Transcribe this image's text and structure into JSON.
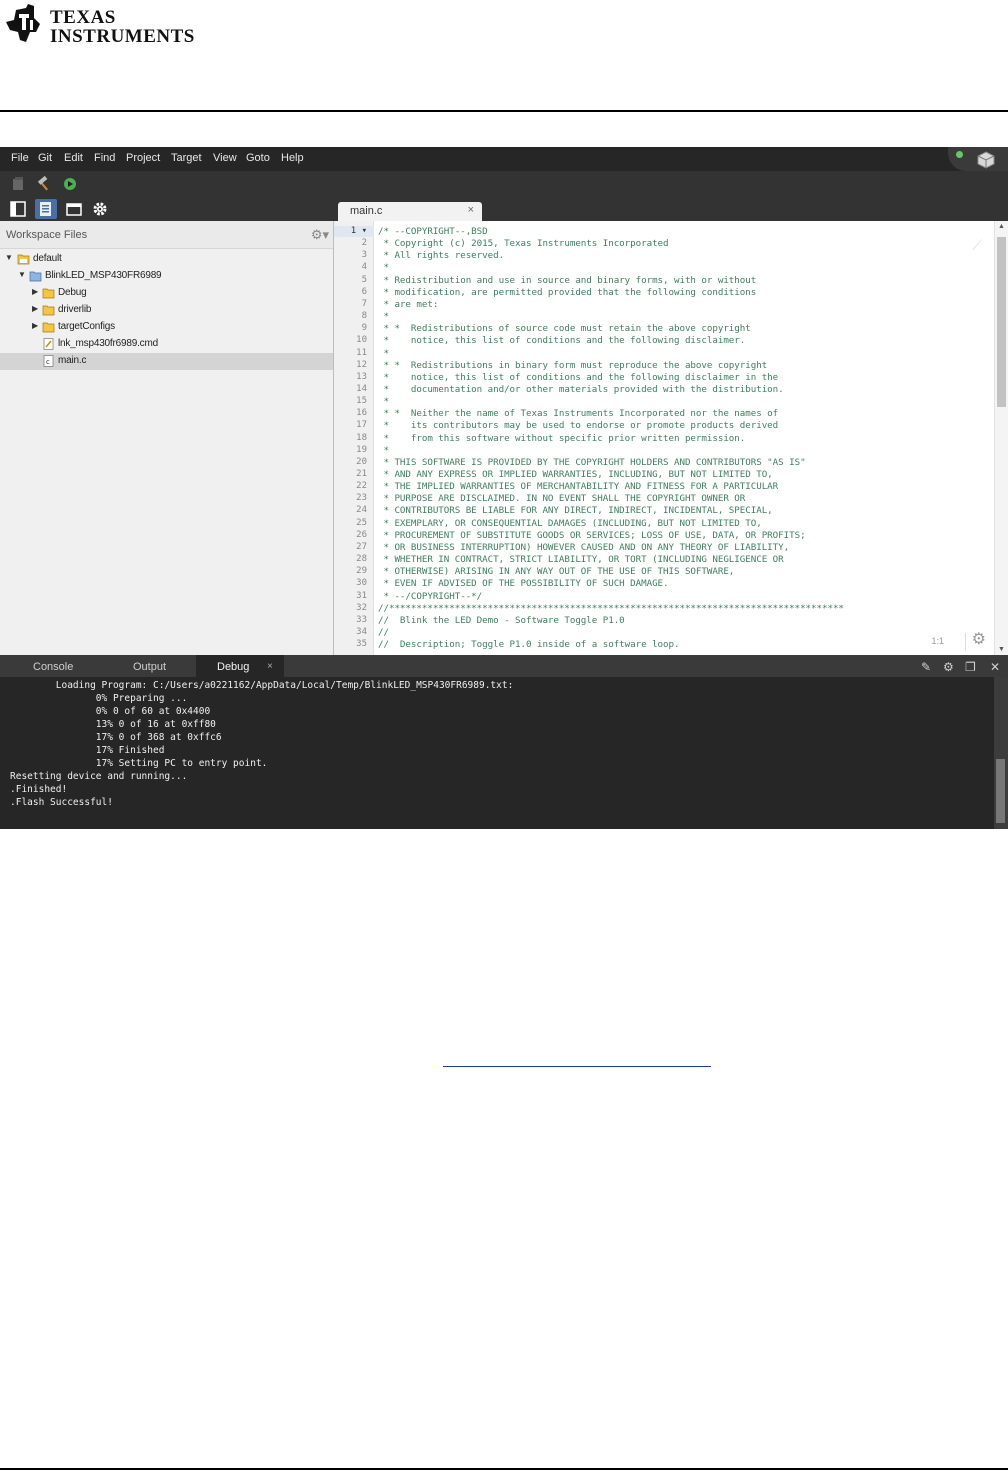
{
  "brand": {
    "line1": "Texas",
    "line2": "Instruments",
    "logo_color": "#cc0000"
  },
  "menubar": {
    "items": [
      "File",
      "Git",
      "Edit",
      "Find",
      "Project",
      "Target",
      "View",
      "Goto",
      "Help"
    ]
  },
  "editor": {
    "tab_label": "main.c",
    "tab_close": "×",
    "position": "1:1",
    "code_lines": [
      "/* --COPYRIGHT--,BSD",
      " * Copyright (c) 2015, Texas Instruments Incorporated",
      " * All rights reserved.",
      " *",
      " * Redistribution and use in source and binary forms, with or without",
      " * modification, are permitted provided that the following conditions",
      " * are met:",
      " *",
      " * *  Redistributions of source code must retain the above copyright",
      " *    notice, this list of conditions and the following disclaimer.",
      " *",
      " * *  Redistributions in binary form must reproduce the above copyright",
      " *    notice, this list of conditions and the following disclaimer in the",
      " *    documentation and/or other materials provided with the distribution.",
      " *",
      " * *  Neither the name of Texas Instruments Incorporated nor the names of",
      " *    its contributors may be used to endorse or promote products derived",
      " *    from this software without specific prior written permission.",
      " *",
      " * THIS SOFTWARE IS PROVIDED BY THE COPYRIGHT HOLDERS AND CONTRIBUTORS \"AS IS\"",
      " * AND ANY EXPRESS OR IMPLIED WARRANTIES, INCLUDING, BUT NOT LIMITED TO,",
      " * THE IMPLIED WARRANTIES OF MERCHANTABILITY AND FITNESS FOR A PARTICULAR",
      " * PURPOSE ARE DISCLAIMED. IN NO EVENT SHALL THE COPYRIGHT OWNER OR",
      " * CONTRIBUTORS BE LIABLE FOR ANY DIRECT, INDIRECT, INCIDENTAL, SPECIAL,",
      " * EXEMPLARY, OR CONSEQUENTIAL DAMAGES (INCLUDING, BUT NOT LIMITED TO,",
      " * PROCUREMENT OF SUBSTITUTE GOODS OR SERVICES; LOSS OF USE, DATA, OR PROFITS;",
      " * OR BUSINESS INTERRUPTION) HOWEVER CAUSED AND ON ANY THEORY OF LIABILITY,",
      " * WHETHER IN CONTRACT, STRICT LIABILITY, OR TORT (INCLUDING NEGLIGENCE OR",
      " * OTHERWISE) ARISING IN ANY WAY OUT OF THE USE OF THIS SOFTWARE,",
      " * EVEN IF ADVISED OF THE POSSIBILITY OF SUCH DAMAGE.",
      " * --/COPYRIGHT--*/",
      "//***********************************************************************************",
      "//  Blink the LED Demo - Software Toggle P1.0",
      "//",
      "//  Description; Toggle P1.0 inside of a software loop."
    ],
    "comment_color": "#3f7f5f"
  },
  "workspace": {
    "title": "Workspace Files",
    "tree": [
      {
        "label": "default",
        "icon": "workspace-folder-icon",
        "expanded": true
      },
      {
        "label": "BlinkLED_MSP430FR6989",
        "icon": "project-folder-icon",
        "expanded": true
      },
      {
        "label": "Debug",
        "icon": "folder-icon",
        "expanded": false
      },
      {
        "label": "driverlib",
        "icon": "folder-icon",
        "expanded": false
      },
      {
        "label": "targetConfigs",
        "icon": "folder-icon",
        "expanded": false
      },
      {
        "label": "lnk_msp430fr6989.cmd",
        "icon": "cmd-file-icon"
      },
      {
        "label": "main.c",
        "icon": "c-file-icon",
        "selected": true
      }
    ]
  },
  "bottom_panel": {
    "tabs": [
      "Console",
      "Output",
      "Debug"
    ],
    "active_tab": "Debug",
    "close": "×",
    "console_lines": [
      "        Loading Program: C:/Users/a0221162/AppData/Local/Temp/BlinkLED_MSP430FR6989.txt:",
      "               0% Preparing ...",
      "               0% 0 of 60 at 0x4400",
      "               13% 0 of 16 at 0xff80",
      "               17% 0 of 368 at 0xffc6",
      "               17% Finished",
      "               17% Setting PC to entry point.",
      "Resetting device and running...",
      ".Finished!",
      ".Flash Successful!"
    ]
  }
}
